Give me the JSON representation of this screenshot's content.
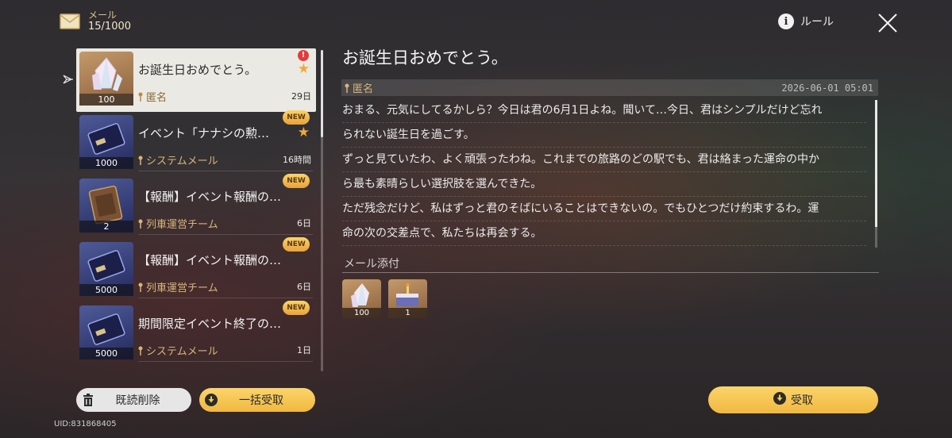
{
  "header": {
    "label": "メール",
    "count": "15/1000"
  },
  "rules_label": "ルール",
  "mails": [
    {
      "title": "お誕生日おめでとう。",
      "sender": "匿名",
      "time": "29日",
      "qty": "100",
      "thumb": "crystal",
      "badge": "",
      "star": true,
      "alert": "!"
    },
    {
      "title": "イベント「ナナシの勲…",
      "sender": "システムメール",
      "time": "16時間",
      "qty": "1000",
      "thumb": "card",
      "badge": "NEW",
      "star": true
    },
    {
      "title": "【報酬】イベント報酬の…",
      "sender": "列車運営チーム",
      "time": "6日",
      "qty": "2",
      "thumb": "book",
      "badge": "NEW",
      "star": false
    },
    {
      "title": "【報酬】イベント報酬の…",
      "sender": "列車運営チーム",
      "time": "6日",
      "qty": "5000",
      "thumb": "card",
      "badge": "NEW",
      "star": false
    },
    {
      "title": "期間限定イベント終了の…",
      "sender": "システムメール",
      "time": "1日",
      "qty": "5000",
      "thumb": "card",
      "badge": "NEW",
      "star": false
    }
  ],
  "buttons": {
    "delete_read": "既読削除",
    "claim_all": "一括受取",
    "claim": "受取"
  },
  "uid": "UID:831868405",
  "detail": {
    "title": "お誕生日おめでとう。",
    "sender": "匿名",
    "date": "2026-06-01 05:01",
    "lines": [
      "おまる、元気にしてるかしら？今日は君の6月1日よね。聞いて…今日、君はシンプルだけど忘れ",
      "られない誕生日を過ごす。",
      "ずっと見ていたわ、よく頑張ったわね。これまでの旅路のどの駅でも、君は絡まった運命の中か",
      "ら最も素晴らしい選択肢を選んできた。",
      "ただ残念だけど、私はずっと君のそばにいることはできないの。でもひとつだけ約束するわ。運",
      "命の次の交差点で、私たちは再会する。"
    ],
    "attachments_label": "メール添付",
    "attachments": [
      {
        "item": "crystal",
        "qty": "100"
      },
      {
        "item": "cake",
        "qty": "1"
      }
    ]
  }
}
